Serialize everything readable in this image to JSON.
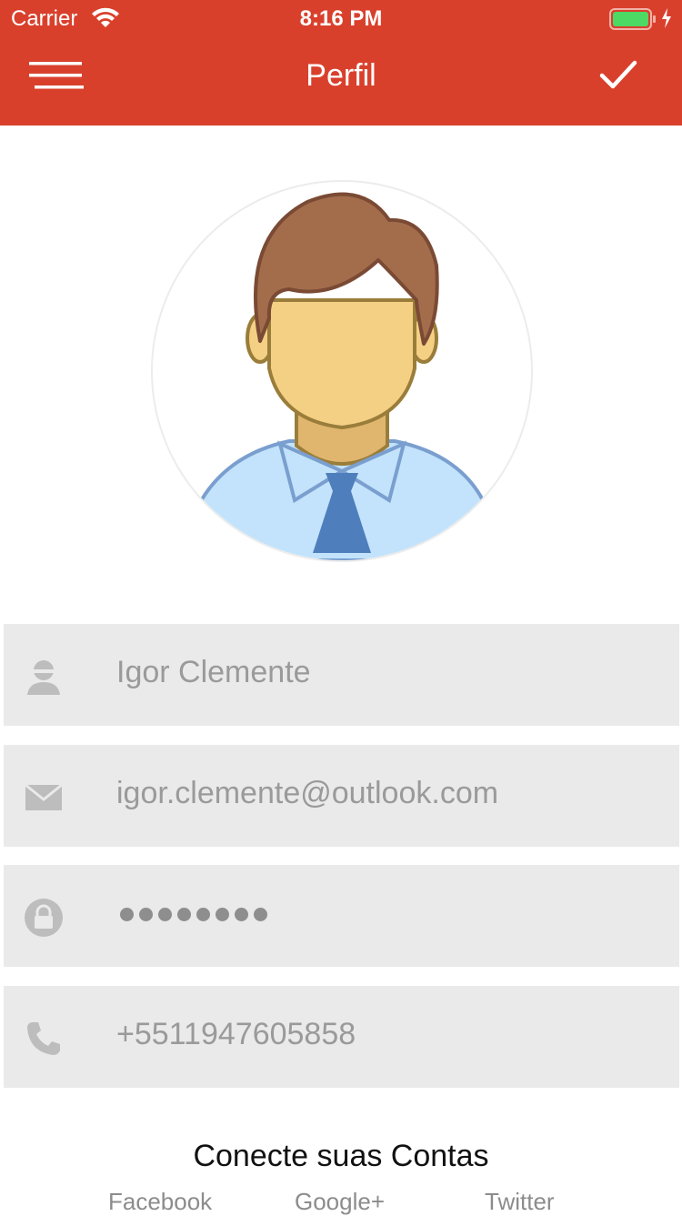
{
  "status_bar": {
    "carrier": "Carrier",
    "time": "8:16 PM"
  },
  "header": {
    "title": "Perfil"
  },
  "profile": {
    "name": "Igor Clemente",
    "email": "igor.clemente@outlook.com",
    "password_mask": "••••••••",
    "phone": "+5511947605858"
  },
  "connect": {
    "title": "Conecte suas Contas",
    "accounts": [
      "Facebook",
      "Google+",
      "Twitter"
    ]
  },
  "colors": {
    "accent": "#d9402c",
    "field_bg": "#eaeaea",
    "field_text": "#9a9a9a"
  }
}
